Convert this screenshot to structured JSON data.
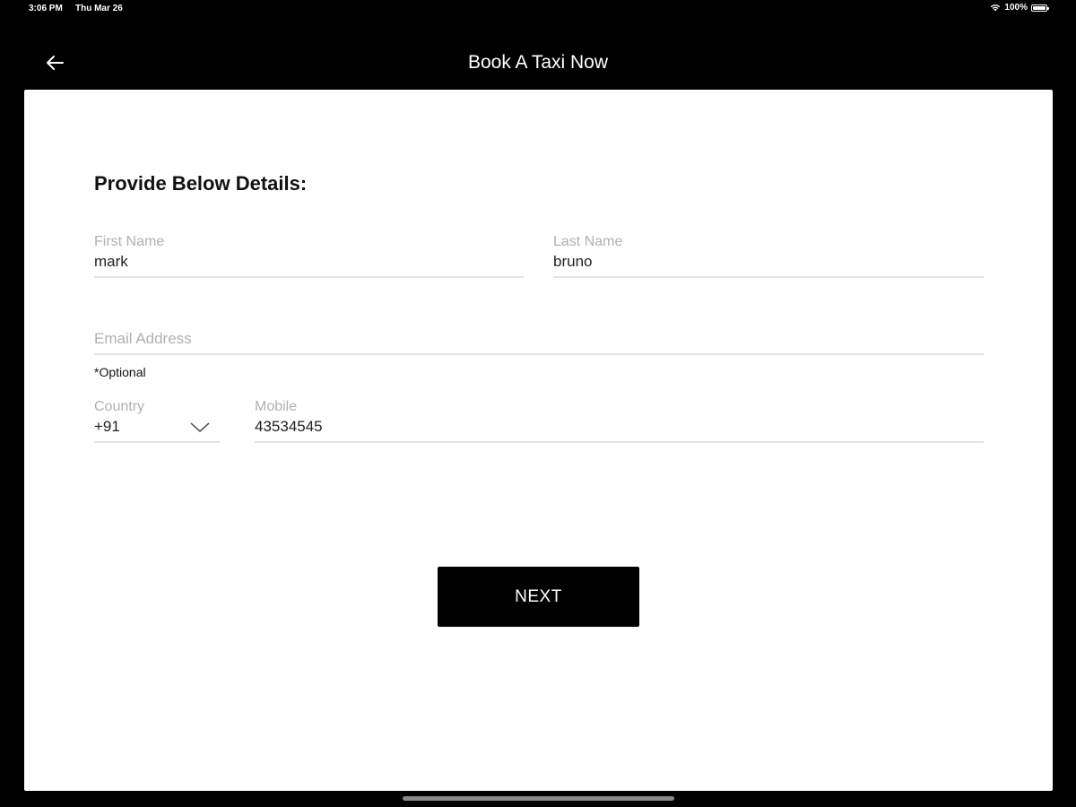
{
  "status_bar": {
    "time": "3:06 PM",
    "date": "Thu Mar 26",
    "battery": "100%",
    "icons": [
      "wifi-icon",
      "battery-icon"
    ]
  },
  "nav": {
    "title": "Book A Taxi Now",
    "back_icon": "arrow-left-icon"
  },
  "form": {
    "heading": "Provide Below Details:",
    "first_name": {
      "label": "First Name",
      "value": "mark"
    },
    "last_name": {
      "label": "Last Name",
      "value": "bruno"
    },
    "email": {
      "placeholder": "Email Address",
      "value": "",
      "note": "*Optional"
    },
    "country": {
      "label": "Country",
      "value": "+91",
      "icon": "chevron-down-icon"
    },
    "mobile": {
      "label": "Mobile",
      "value": "43534545"
    },
    "next_label": "NEXT"
  },
  "colors": {
    "background": "#000000",
    "card": "#ffffff",
    "label": "#b0b0b0",
    "underline": "#e3e3e3",
    "button": "#000000"
  }
}
